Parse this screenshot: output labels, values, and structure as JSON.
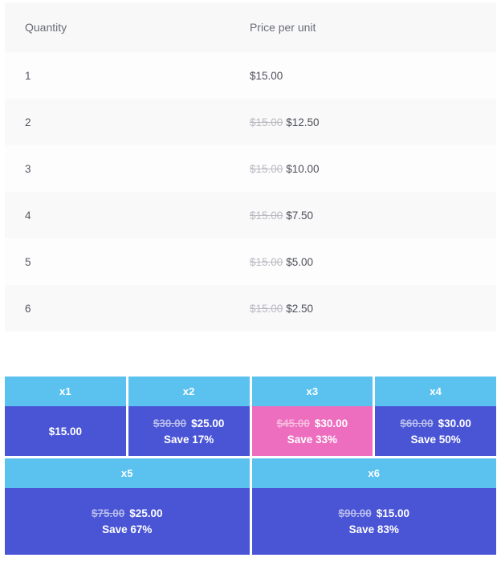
{
  "table": {
    "headers": {
      "quantity": "Quantity",
      "price_per_unit": "Price per unit"
    },
    "rows": [
      {
        "quantity": "1",
        "old_price": "",
        "price": "$15.00"
      },
      {
        "quantity": "2",
        "old_price": "$15.00",
        "price": "$12.50"
      },
      {
        "quantity": "3",
        "old_price": "$15.00",
        "price": "$10.00"
      },
      {
        "quantity": "4",
        "old_price": "$15.00",
        "price": "$7.50"
      },
      {
        "quantity": "5",
        "old_price": "$15.00",
        "price": "$5.00"
      },
      {
        "quantity": "6",
        "old_price": "$15.00",
        "price": "$2.50"
      }
    ]
  },
  "tiers": {
    "row_top": [
      {
        "label": "x1",
        "old_total": "",
        "total": "$15.00",
        "save": "",
        "highlighted": false
      },
      {
        "label": "x2",
        "old_total": "$30.00",
        "total": "$25.00",
        "save": "Save 17%",
        "highlighted": false
      },
      {
        "label": "x3",
        "old_total": "$45.00",
        "total": "$30.00",
        "save": "Save 33%",
        "highlighted": true
      },
      {
        "label": "x4",
        "old_total": "$60.00",
        "total": "$30.00",
        "save": "Save 50%",
        "highlighted": false
      }
    ],
    "row_bottom": [
      {
        "label": "x5",
        "old_total": "$75.00",
        "total": "$25.00",
        "save": "Save 67%",
        "highlighted": false
      },
      {
        "label": "x6",
        "old_total": "$90.00",
        "total": "$15.00",
        "save": "Save 83%",
        "highlighted": false
      }
    ]
  },
  "colors": {
    "tier_header_blue": "#5bc2ef",
    "tier_body_blue": "#4a55d6",
    "tier_body_pink": "#ed6ebf",
    "table_header_bg": "#f8f8f9",
    "row_odd_bg": "#fdfdfe",
    "row_even_bg": "#f9f9fa",
    "strikethrough_gray": "#b9bac0"
  }
}
